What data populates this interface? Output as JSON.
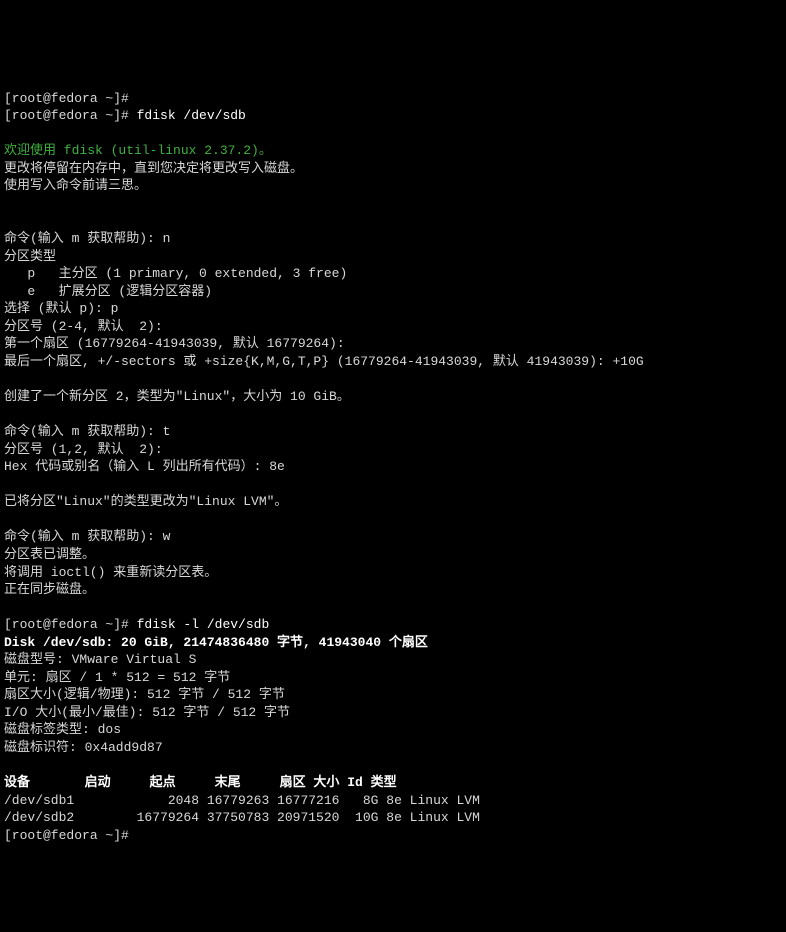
{
  "lines": {
    "l00": "[root@fedora ~]#",
    "l01_pre": "[root@fedora ~]# ",
    "l01_cmd": "fdisk /dev/sdb",
    "l02": "",
    "l03_green": "欢迎使用 fdisk (util-linux 2.37.2)。",
    "l04": "更改将停留在内存中，直到您决定将更改写入磁盘。",
    "l05": "使用写入命令前请三思。",
    "l06": "",
    "l07": "",
    "l08": "命令(输入 m 获取帮助): n",
    "l09": "分区类型",
    "l10": "   p   主分区 (1 primary, 0 extended, 3 free)",
    "l11": "   e   扩展分区 (逻辑分区容器)",
    "l12": "选择 (默认 p): p",
    "l13": "分区号 (2-4, 默认  2):",
    "l14": "第一个扇区 (16779264-41943039, 默认 16779264):",
    "l15": "最后一个扇区, +/-sectors 或 +size{K,M,G,T,P} (16779264-41943039, 默认 41943039): +10G",
    "l16": "",
    "l17": "创建了一个新分区 2，类型为\"Linux\"，大小为 10 GiB。",
    "l18": "",
    "l19": "命令(输入 m 获取帮助): t",
    "l20": "分区号 (1,2, 默认  2):",
    "l21": "Hex 代码或别名（输入 L 列出所有代码）: 8e",
    "l22": "",
    "l23": "已将分区\"Linux\"的类型更改为\"Linux LVM\"。",
    "l24": "",
    "l25": "命令(输入 m 获取帮助): w",
    "l26": "分区表已调整。",
    "l27": "将调用 ioctl() 来重新读分区表。",
    "l28": "正在同步磁盘。",
    "l29": "",
    "l30_pre": "[root@fedora ~]# ",
    "l30_cmd": "fdisk -l /dev/sdb",
    "l31_bold": "Disk /dev/sdb: 20 GiB, 21474836480 字节, 41943040 个扇区",
    "l32": "磁盘型号: VMware Virtual S",
    "l33": "单元: 扇区 / 1 * 512 = 512 字节",
    "l34": "扇区大小(逻辑/物理): 512 字节 / 512 字节",
    "l35": "I/O 大小(最小/最佳): 512 字节 / 512 字节",
    "l36": "磁盘标签类型: dos",
    "l37": "磁盘标识符: 0x4add9d87",
    "l38": "",
    "l39_bold": "设备       启动     起点     末尾     扇区 大小 Id 类型",
    "l40": "/dev/sdb1            2048 16779263 16777216   8G 8e Linux LVM",
    "l41": "/dev/sdb2        16779264 37750783 20971520  10G 8e Linux LVM",
    "l42_pre": "[root@fedora ~]#"
  }
}
